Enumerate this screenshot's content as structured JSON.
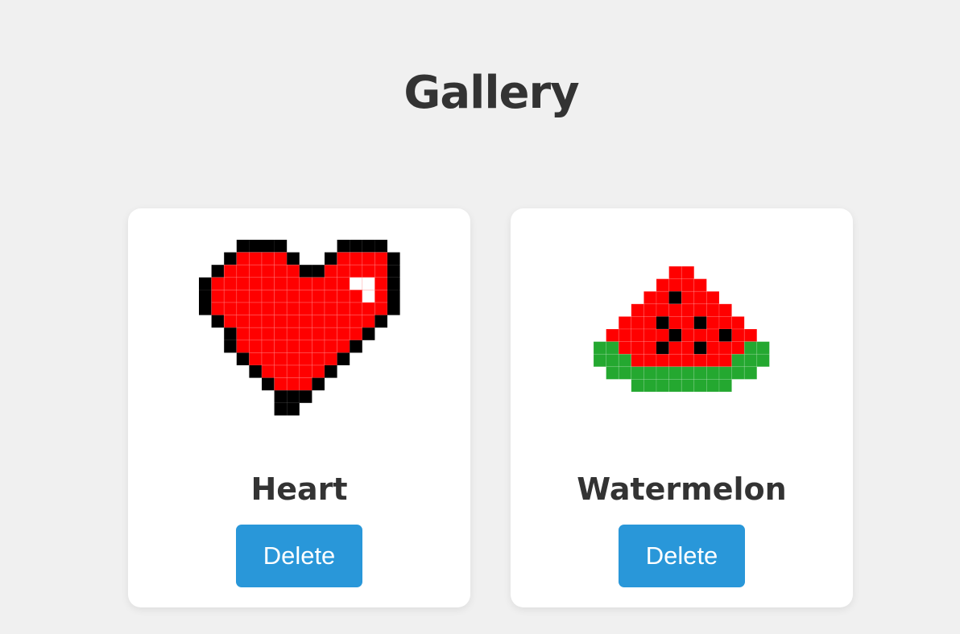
{
  "page": {
    "title": "Gallery"
  },
  "gallery": {
    "items": [
      {
        "name": "Heart",
        "delete_label": "Delete",
        "icon": "pixel-heart",
        "colors": {
          "outline": "#000000",
          "fill": "#ff0000",
          "highlight": "#ffffff"
        }
      },
      {
        "name": "Watermelon",
        "delete_label": "Delete",
        "icon": "pixel-watermelon",
        "colors": {
          "flesh": "#ff0000",
          "seed": "#000000",
          "rind": "#24a830"
        }
      }
    ]
  },
  "colors": {
    "background": "#f0f0f0",
    "card": "#ffffff",
    "button": "#2997d9",
    "text": "#333333"
  }
}
